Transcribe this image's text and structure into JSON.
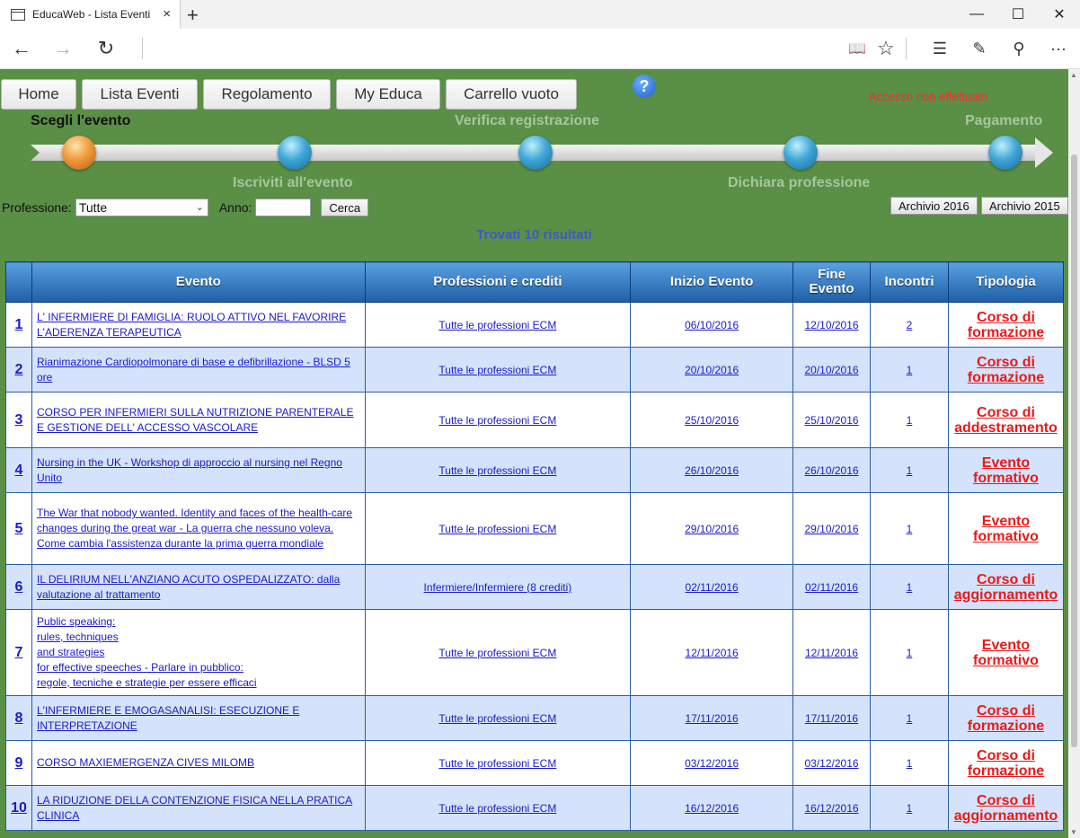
{
  "browser": {
    "tab_title": "EducaWeb - Lista Eventi",
    "tab_close": "×",
    "new_tab": "+",
    "window": {
      "minimize": "—",
      "maximize": "☐",
      "close": "✕"
    },
    "nav": {
      "back": "←",
      "forward": "→",
      "refresh": "↻",
      "reading_view": "📖",
      "favorite": "☆",
      "hub": "☰",
      "notes": "✎",
      "share": "⚲",
      "more": "···"
    }
  },
  "menu": {
    "home": "Home",
    "events": "Lista Eventi",
    "rules": "Regolamento",
    "my_educa": "My Educa",
    "cart": "Carrello vuoto"
  },
  "help_icon": "?",
  "access_status": "Accesso non effettuato",
  "colors": {
    "page_bg": "#5a8f46",
    "header_blue": "#1f5fa8",
    "link_blue": "#1a1acb",
    "type_red": "#e81a1a",
    "access_red": "#ff2a2a"
  },
  "steps": {
    "s1": "Scegli l'evento",
    "s2": "Iscriviti all'evento",
    "s3": "Verifica registrazione",
    "s4": "Dichiara professione",
    "s5": "Pagamento"
  },
  "filters": {
    "profession_label": "Professione:",
    "profession_value": "Tutte",
    "year_label": "Anno:",
    "search_button": "Cerca",
    "archive_2016": "Archivio 2016",
    "archive_2015": "Archivio 2015"
  },
  "results_text": "Trovati 10 risultati",
  "table": {
    "headers": [
      "",
      "Evento",
      "Professioni e crediti",
      "Inizio Evento",
      "Fine Evento",
      "Incontri",
      "Tipologia"
    ],
    "rows": [
      {
        "n": "1",
        "event": "L' INFERMIERE DI FAMIGLIA: RUOLO ATTIVO NEL FAVORIRE L'ADERENZA TERAPEUTICA",
        "prof": "Tutte le professioni ECM",
        "start": "06/10/2016",
        "end": "12/10/2016",
        "meet": "2",
        "type": "Corso di formazione"
      },
      {
        "n": "2",
        "event": "Rianimazione Cardiopolmonare di base e defibrillazione - BLSD 5 ore",
        "prof": "Tutte le professioni ECM",
        "start": "20/10/2016",
        "end": "20/10/2016",
        "meet": "1",
        "type": "Corso di formazione"
      },
      {
        "n": "3",
        "event": "CORSO PER INFERMIERI SULLA NUTRIZIONE PARENTERALE E GESTIONE DELL' ACCESSO VASCOLARE",
        "prof": "Tutte le professioni ECM",
        "start": "25/10/2016",
        "end": "25/10/2016",
        "meet": "1",
        "type": "Corso di addestramento"
      },
      {
        "n": "4",
        "event": "Nursing in the UK - Workshop di approccio al nursing nel Regno Unito",
        "prof": "Tutte le professioni ECM",
        "start": "26/10/2016",
        "end": "26/10/2016",
        "meet": "1",
        "type": "Evento formativo"
      },
      {
        "n": "5",
        "event": "The War that nobody wanted. Identity and faces of the health-care changes during the great war - La guerra che nessuno voleva. Come cambia l'assistenza durante la prima guerra mondiale",
        "prof": "Tutte le professioni ECM",
        "start": "29/10/2016",
        "end": "29/10/2016",
        "meet": "1",
        "type": "Evento formativo"
      },
      {
        "n": "6",
        "event": "IL DELIRIUM NELL'ANZIANO ACUTO OSPEDALIZZATO: dalla valutazione al trattamento",
        "prof": "Infermiere/Infermiere (8 crediti)",
        "start": "02/11/2016",
        "end": "02/11/2016",
        "meet": "1",
        "type": "Corso di aggiornamento"
      },
      {
        "n": "7",
        "event": "Public speaking:\nrules, techniques\nand strategies\nfor effective speeches - Parlare in pubblico:\nregole, tecniche e strategie per essere efficaci",
        "prof": "Tutte le professioni ECM",
        "start": "12/11/2016",
        "end": "12/11/2016",
        "meet": "1",
        "type": "Evento formativo"
      },
      {
        "n": "8",
        "event": "L'INFERMIERE E EMOGASANALISI: ESECUZIONE E INTERPRETAZIONE",
        "prof": "Tutte le professioni ECM",
        "start": "17/11/2016",
        "end": "17/11/2016",
        "meet": "1",
        "type": "Corso di formazione"
      },
      {
        "n": "9",
        "event": "CORSO MAXIEMERGENZA CIVES MILOMB",
        "prof": "Tutte le professioni ECM",
        "start": "03/12/2016",
        "end": "03/12/2016",
        "meet": "1",
        "type": "Corso di formazione"
      },
      {
        "n": "10",
        "event": "LA RIDUZIONE DELLA CONTENZIONE FISICA NELLA PRATICA CLINICA",
        "prof": "Tutte le professioni ECM",
        "start": "16/12/2016",
        "end": "16/12/2016",
        "meet": "1",
        "type": "Corso di aggiornamento"
      }
    ]
  }
}
